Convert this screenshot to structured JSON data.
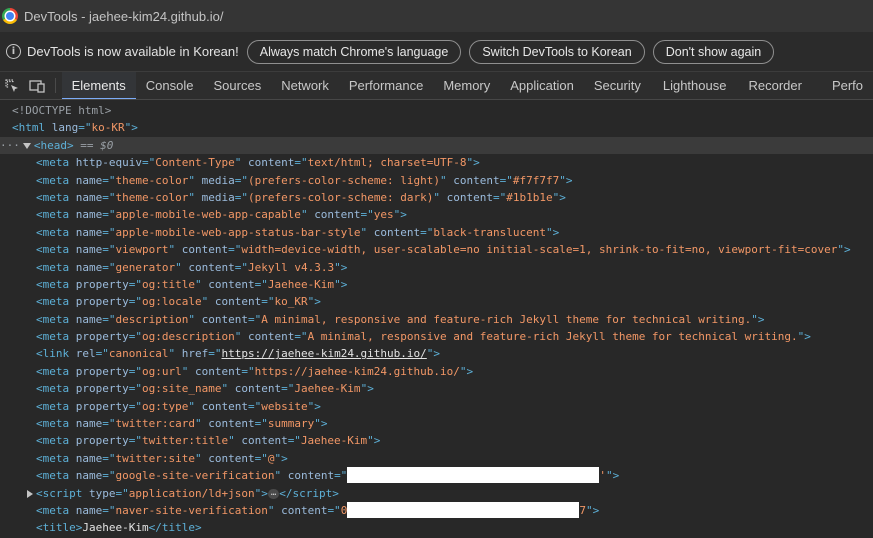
{
  "window": {
    "title": "DevTools - jaehee-kim24.github.io/"
  },
  "infobar": {
    "message": "DevTools is now available in Korean!",
    "buttons": [
      "Always match Chrome's language",
      "Switch DevTools to Korean",
      "Don't show again"
    ]
  },
  "tabs": {
    "items": [
      "Elements",
      "Console",
      "Sources",
      "Network",
      "Performance",
      "Memory",
      "Application",
      "Security",
      "Lighthouse",
      "Recorder",
      "Perfo"
    ],
    "active": "Elements"
  },
  "icons": {
    "inspect": "inspect-element-icon",
    "device": "device-toolbar-icon",
    "app": "chrome-logo-icon",
    "info": "info-icon"
  },
  "dom": {
    "doctype": "<!DOCTYPE html>",
    "html_open": {
      "tag": "html",
      "attrs": [
        [
          "lang",
          "ko-KR"
        ]
      ]
    },
    "head_marker": "== $0",
    "children": [
      {
        "tag": "meta",
        "attrs": [
          [
            "http-equiv",
            "Content-Type"
          ],
          [
            "content",
            "text/html; charset=UTF-8"
          ]
        ]
      },
      {
        "tag": "meta",
        "attrs": [
          [
            "name",
            "theme-color"
          ],
          [
            "media",
            "(prefers-color-scheme: light)"
          ],
          [
            "content",
            "#f7f7f7"
          ]
        ]
      },
      {
        "tag": "meta",
        "attrs": [
          [
            "name",
            "theme-color"
          ],
          [
            "media",
            "(prefers-color-scheme: dark)"
          ],
          [
            "content",
            "#1b1b1e"
          ]
        ]
      },
      {
        "tag": "meta",
        "attrs": [
          [
            "name",
            "apple-mobile-web-app-capable"
          ],
          [
            "content",
            "yes"
          ]
        ]
      },
      {
        "tag": "meta",
        "attrs": [
          [
            "name",
            "apple-mobile-web-app-status-bar-style"
          ],
          [
            "content",
            "black-translucent"
          ]
        ]
      },
      {
        "tag": "meta",
        "attrs": [
          [
            "name",
            "viewport"
          ],
          [
            "content",
            "width=device-width, user-scalable=no initial-scale=1, shrink-to-fit=no, viewport-fit=cover"
          ]
        ]
      },
      {
        "tag": "meta",
        "attrs": [
          [
            "name",
            "generator"
          ],
          [
            "content",
            "Jekyll v4.3.3"
          ]
        ]
      },
      {
        "tag": "meta",
        "attrs": [
          [
            "property",
            "og:title"
          ],
          [
            "content",
            "Jaehee-Kim"
          ]
        ]
      },
      {
        "tag": "meta",
        "attrs": [
          [
            "property",
            "og:locale"
          ],
          [
            "content",
            "ko_KR"
          ]
        ]
      },
      {
        "tag": "meta",
        "attrs": [
          [
            "name",
            "description"
          ],
          [
            "content",
            "A minimal, responsive and feature-rich Jekyll theme for technical writing."
          ]
        ]
      },
      {
        "tag": "meta",
        "attrs": [
          [
            "property",
            "og:description"
          ],
          [
            "content",
            "A minimal, responsive and feature-rich Jekyll theme for technical writing."
          ]
        ]
      },
      {
        "tag": "link",
        "attrs": [
          [
            "rel",
            "canonical"
          ],
          [
            "href",
            "https://jaehee-kim24.github.io/"
          ]
        ],
        "link_attr": "href"
      },
      {
        "tag": "meta",
        "attrs": [
          [
            "property",
            "og:url"
          ],
          [
            "content",
            "https://jaehee-kim24.github.io/"
          ]
        ]
      },
      {
        "tag": "meta",
        "attrs": [
          [
            "property",
            "og:site_name"
          ],
          [
            "content",
            "Jaehee-Kim"
          ]
        ]
      },
      {
        "tag": "meta",
        "attrs": [
          [
            "property",
            "og:type"
          ],
          [
            "content",
            "website"
          ]
        ]
      },
      {
        "tag": "meta",
        "attrs": [
          [
            "name",
            "twitter:card"
          ],
          [
            "content",
            "summary"
          ]
        ]
      },
      {
        "tag": "meta",
        "attrs": [
          [
            "property",
            "twitter:title"
          ],
          [
            "content",
            "Jaehee-Kim"
          ]
        ]
      },
      {
        "tag": "meta",
        "attrs": [
          [
            "name",
            "twitter:site"
          ],
          [
            "content",
            "@"
          ]
        ]
      },
      {
        "tag": "meta",
        "attrs": [
          [
            "name",
            "google-site-verification"
          ]
        ],
        "redacted": {
          "prefix": "",
          "suffix": "'"
        }
      },
      {
        "tag": "script",
        "attrs": [
          [
            "type",
            "application/ld+json"
          ]
        ],
        "collapsed": true,
        "ellipsis": "…"
      },
      {
        "tag": "meta",
        "attrs": [
          [
            "name",
            "naver-site-verification"
          ]
        ],
        "redacted": {
          "prefix": "0",
          "suffix": "7"
        }
      },
      {
        "tag": "title",
        "text": "Jaehee-Kim"
      }
    ]
  }
}
